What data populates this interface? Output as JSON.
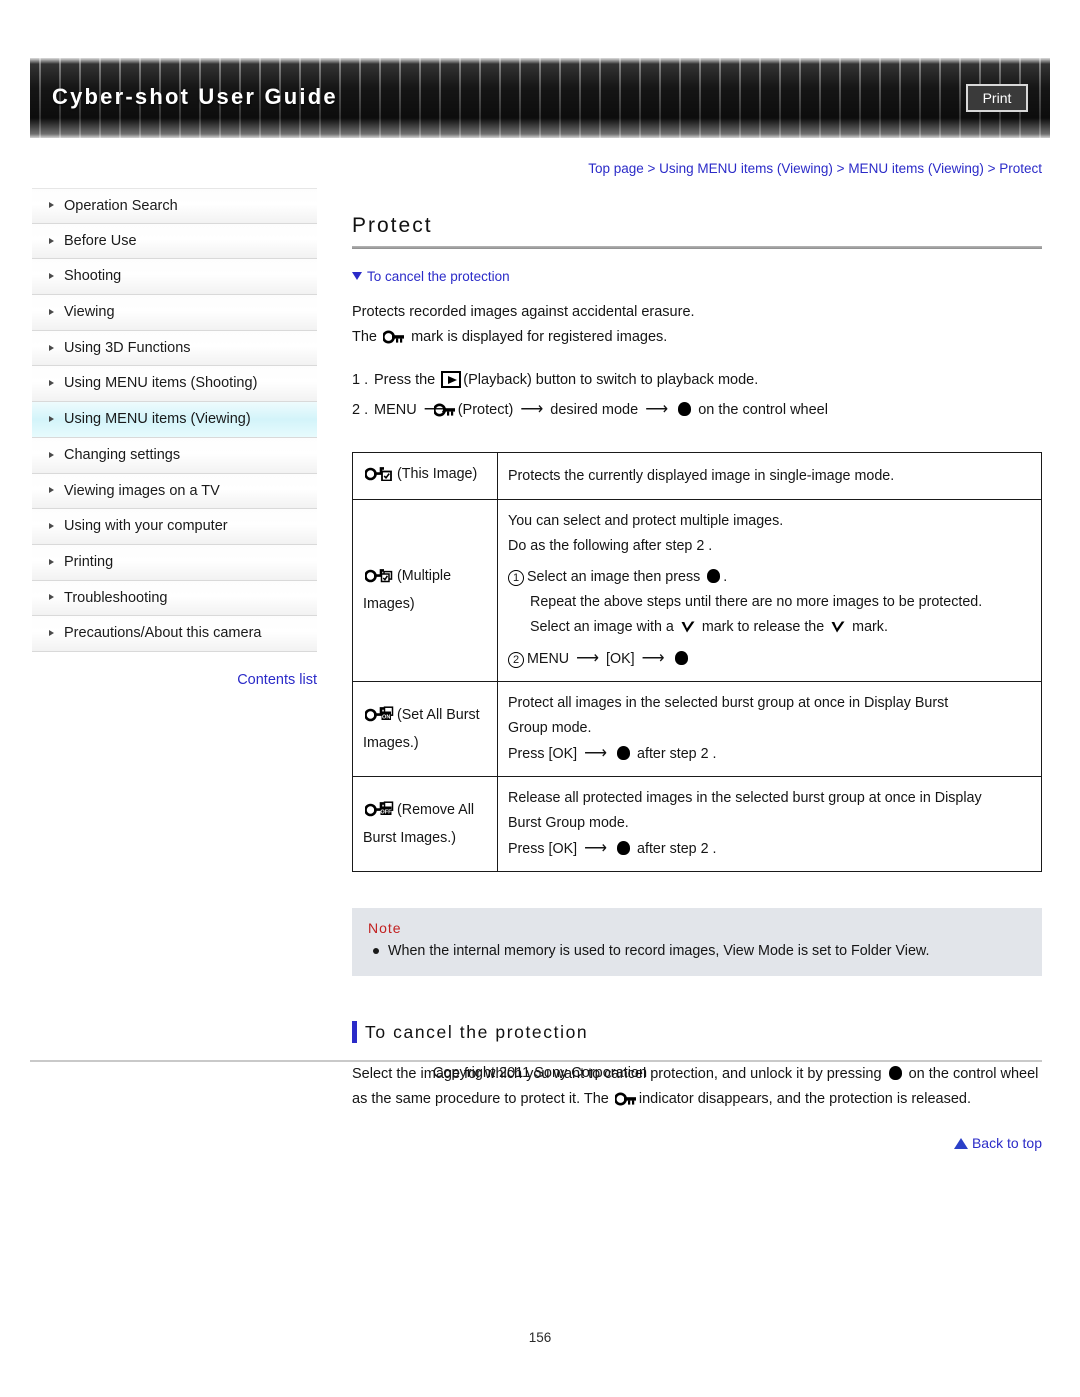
{
  "header": {
    "title": "Cyber-shot User Guide",
    "print_label": "Print"
  },
  "sidebar": {
    "items": [
      {
        "label": "Operation Search",
        "selected": false
      },
      {
        "label": "Before Use",
        "selected": false
      },
      {
        "label": "Shooting",
        "selected": false
      },
      {
        "label": "Viewing",
        "selected": false
      },
      {
        "label": "Using 3D Functions",
        "selected": false
      },
      {
        "label": "Using MENU items (Shooting)",
        "selected": false
      },
      {
        "label": "Using MENU items (Viewing)",
        "selected": true
      },
      {
        "label": "Changing settings",
        "selected": false
      },
      {
        "label": "Viewing images on a TV",
        "selected": false
      },
      {
        "label": "Using with your computer",
        "selected": false
      },
      {
        "label": "Printing",
        "selected": false
      },
      {
        "label": "Troubleshooting",
        "selected": false
      },
      {
        "label": "Precautions/About this camera",
        "selected": false
      }
    ],
    "contents_link": "Contents list"
  },
  "breadcrumb": "Top page > Using MENU items (Viewing) > MENU items (Viewing) > Protect",
  "page": {
    "title": "Protect",
    "anchor_link": "To cancel the protection",
    "intro_line_1": "Protects recorded images against accidental erasure.",
    "intro_line_2_before": "The",
    "intro_line_2_after": "mark is displayed for registered images.",
    "steps": [
      {
        "num": "1 .",
        "before": "Press the",
        "after": "(Playback) button to switch to playback mode."
      },
      {
        "num": "2 .",
        "part_a": "MENU",
        "part_b": "(Protect)",
        "part_c": "desired mode",
        "part_d": "on the control wheel"
      }
    ]
  },
  "table": {
    "rows": [
      {
        "mode": "(This Image)",
        "icon": "protect-this-image-icon",
        "lines": [
          {
            "text": "Protects the currently displayed image in single-image mode."
          }
        ]
      },
      {
        "mode": "(Multiple Images)",
        "icon": "protect-multiple-images-icon",
        "lines": [
          {
            "text": "You can select and protect multiple images."
          },
          {
            "text": "Do as the following after step 2 ."
          },
          {
            "text": "Select an image then press",
            "circle": "1",
            "dot_after": true,
            "period": "."
          },
          {
            "text": "Repeat the above steps until there are no more images to be protected.",
            "indent": true
          },
          {
            "text_a": "Select an image with a",
            "text_b": "mark to release the",
            "text_c": "mark.",
            "check": true,
            "indent": true
          },
          {
            "text": "MENU",
            "circle": "2",
            "ok": "[OK]",
            "dot_end": true
          }
        ]
      },
      {
        "mode": "(Set All Burst Images.)",
        "icon": "protect-set-all-burst-icon",
        "lines": [
          {
            "text": "Protect all images in the selected burst group at once in Display Burst"
          },
          {
            "text": "Group mode."
          },
          {
            "text": "Press [OK]",
            "after": "after step 2 .",
            "arrow_dot": true
          }
        ]
      },
      {
        "mode": "(Remove All Burst Images.)",
        "icon": "protect-remove-all-burst-icon",
        "lines": [
          {
            "text": "Release all protected images in the selected burst group at once in Display"
          },
          {
            "text": "Burst Group mode."
          },
          {
            "text": "Press [OK]",
            "after": "after step 2 .",
            "arrow_dot": true
          }
        ]
      }
    ]
  },
  "note": {
    "heading": "Note",
    "items": [
      "When the internal memory is used to record images, View Mode is set to Folder View."
    ]
  },
  "section": {
    "heading": "To cancel the protection",
    "body_1": "Select the image for which you want to cancel protection, and unlock it by pressing",
    "body_2": "on the",
    "body_3": "control wheel as the same procedure to protect it. The",
    "body_4": "indicator disappears, and the",
    "body_5": "protection is released."
  },
  "footer": {
    "back_to_top": "Back to top",
    "copyright": "Copyright 2011 Sony Corporation",
    "page_number": "156"
  },
  "colors": {
    "link": "#2b2bc8",
    "note_heading": "#c22020",
    "selected_row": "#d3f4fa",
    "banner": "#1c1c1c"
  }
}
